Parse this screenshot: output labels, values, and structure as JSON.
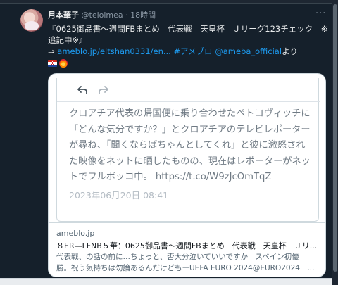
{
  "tweet": {
    "display_name": "月本華子",
    "handle": "@telolmea",
    "separator": "·",
    "time": "18時間",
    "more_label": "···",
    "text_line1": "『0625御品書～週間FBまとめ　代表戦　天皇杯　Ｊリーグ123チェック　※",
    "text_line2": "追記中※』",
    "text_prefix": "⇒ ",
    "link_url": "ameblo.jp/eltshan0331/en...",
    "hashtag": "#アメブロ",
    "mention": "@ameba_official",
    "text_suffix": "より"
  },
  "flags": [
    "croatia-flag",
    "fire-emblem"
  ],
  "embed": {
    "body_lines": [
      "クロアチア代表の帰国便に乗り合わせたペトコヴィッチに",
      "「どんな気分ですか？」とクロアチアのテレビレポーター",
      "が尋ね、「聞くならばちゃんとしてくれ」と彼に激怒され",
      "た映像をネットに晒したものの、現在はレポーターがネッ",
      "トでフルボッコ中。 https://t.co/W9zJcOmTqZ"
    ],
    "date": "2023年06月20日 08:41"
  },
  "card": {
    "domain": "ameblo.jp",
    "title": "８ER—LFNB５華：0625御品書～週間FBまとめ　代表戦　天皇杯　Ｊリ...",
    "desc_line1": "代表戦、の話の前に…ちょっと、否大分泣いていいですか　スペイン初優",
    "desc_line2": "勝。祝う気持ちは勿論あるんだけどもーUEFA EURO 2024@EURO2024　..."
  },
  "colors": {
    "background": "#15202b",
    "link": "#1d9bf0",
    "secondary_text": "#8b98a5",
    "card_bg": "#ffffff"
  }
}
